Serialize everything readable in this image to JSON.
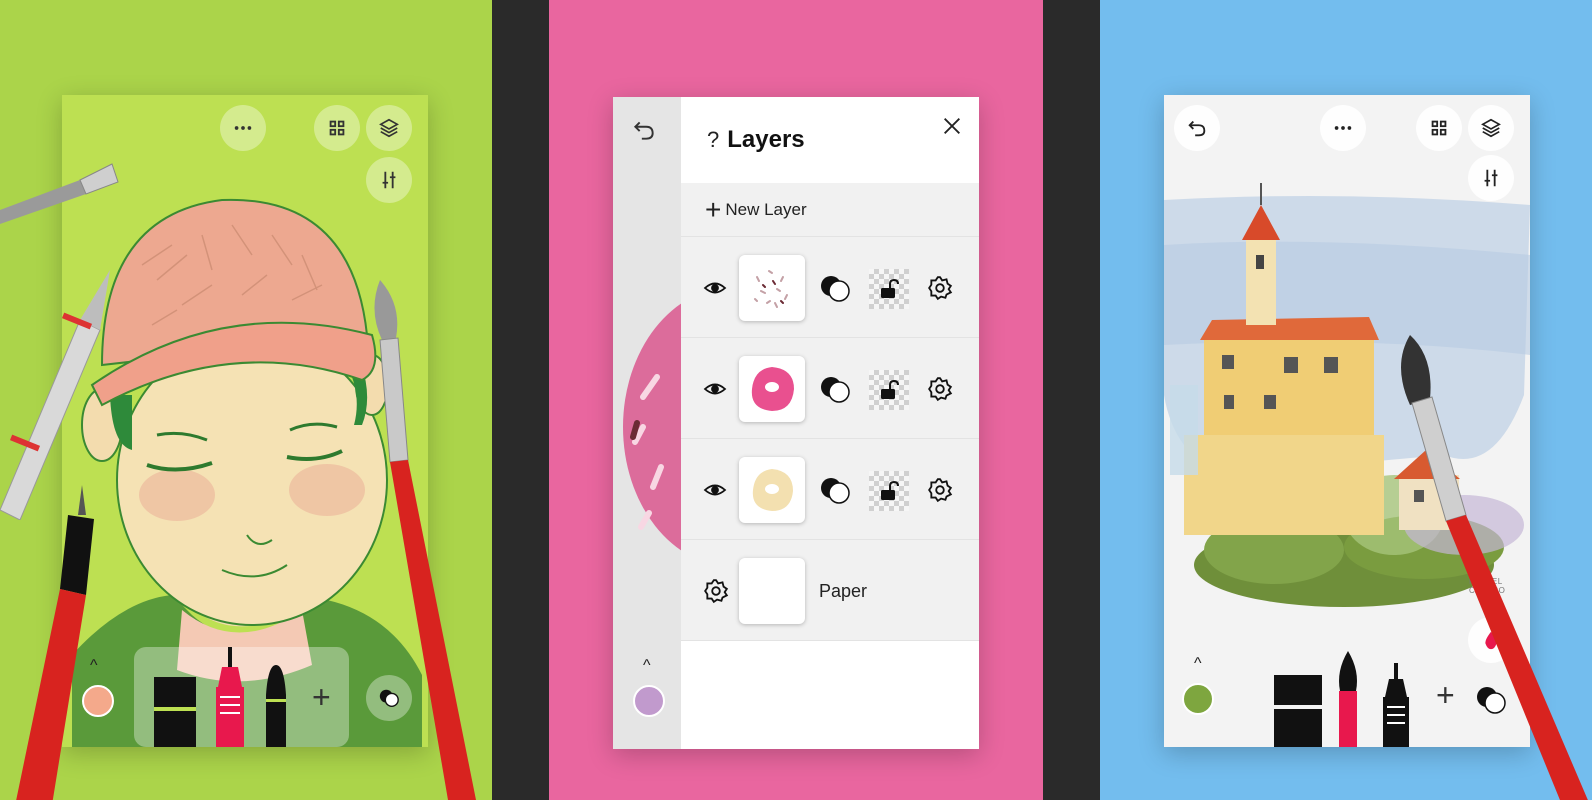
{
  "panels": [
    {
      "background": "#abd44a",
      "phone_background": "#bde052",
      "color_swatch": "#f4a98b"
    },
    {
      "background": "#e9669f",
      "color_swatch": "#c19acd"
    },
    {
      "background": "#73bdee",
      "color_swatch": "#7ea63f",
      "ink_drop": "#e8184d"
    }
  ],
  "layers_panel": {
    "help_label": "?",
    "title": "Layers",
    "new_layer_label": "New Layer",
    "layers": [
      {
        "thumbnail": "sprinkles"
      },
      {
        "thumbnail": "pink-donut",
        "color": "#e9508f"
      },
      {
        "thumbnail": "cream-donut",
        "color": "#f3e0b0"
      }
    ],
    "paper_label": "Paper"
  },
  "caption_text": {
    "signature": "MIGUEL CASTRO"
  },
  "tools": {
    "left": [
      "marker",
      "fineliner",
      "pen"
    ],
    "right": [
      "marker",
      "brush",
      "fineliner"
    ]
  }
}
